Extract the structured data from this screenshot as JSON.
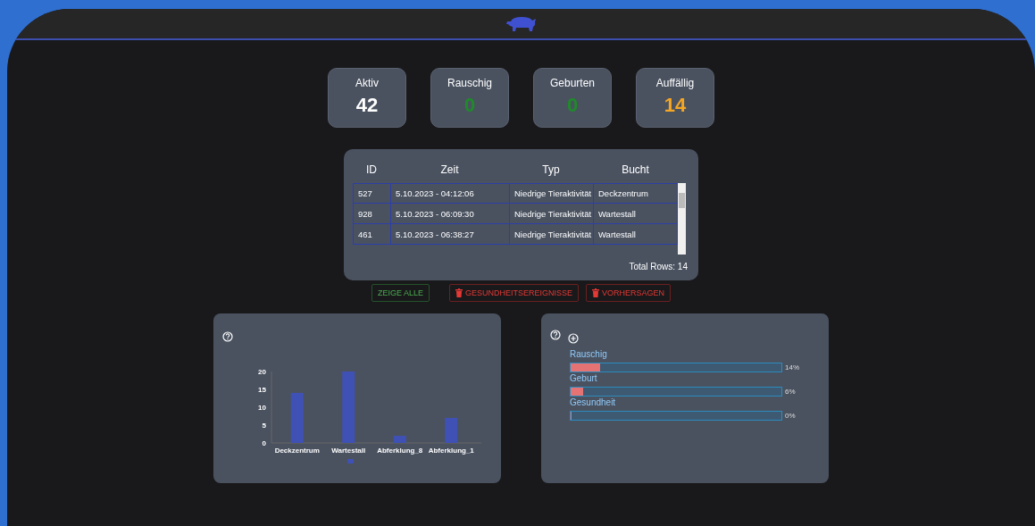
{
  "stats": [
    {
      "label": "Aktiv",
      "value": "42",
      "color": "#ffffff"
    },
    {
      "label": "Rauschig",
      "value": "0",
      "color": "#1f8a2a"
    },
    {
      "label": "Geburten",
      "value": "0",
      "color": "#1f8a2a"
    },
    {
      "label": "Auffällig",
      "value": "14",
      "color": "#f5a623"
    }
  ],
  "table": {
    "columns": [
      "ID",
      "Zeit",
      "Typ",
      "Bucht"
    ],
    "rows": [
      [
        "527",
        "5.10.2023 - 04:12:06",
        "Niedrige Tieraktivität",
        "Deckzentrum"
      ],
      [
        "928",
        "5.10.2023 - 06:09:30",
        "Niedrige Tieraktivität",
        "Wartestall"
      ],
      [
        "461",
        "5.10.2023 - 06:38:27",
        "Niedrige Tieraktivität",
        "Wartestall"
      ]
    ],
    "total": "Total Rows: 14"
  },
  "buttons": [
    {
      "label": "ZEIGE ALLE",
      "kind": "plain"
    },
    {
      "label": "GESUNDHEITSEREIGNISSE",
      "kind": "delete"
    },
    {
      "label": "VORHERSAGEN",
      "kind": "delete"
    }
  ],
  "chart": {
    "chart_data": {
      "type": "bar",
      "categories": [
        "Deckzentrum",
        "Wartestall",
        "Abferklung_8",
        "Abferklung_1"
      ],
      "series": [
        {
          "color": "#3f51b5",
          "values": [
            14,
            20,
            2,
            7
          ]
        }
      ],
      "ylim": [
        0,
        20
      ],
      "yticks": [
        0,
        5,
        10,
        15,
        20
      ]
    }
  },
  "progress": [
    {
      "label": "Rauschig",
      "level": 0.14,
      "reading": "14%"
    },
    {
      "label": "Geburt",
      "level": 0.06,
      "reading": "6%"
    },
    {
      "label": "Gesundheit",
      "level": 0,
      "reading": "0%"
    }
  ]
}
